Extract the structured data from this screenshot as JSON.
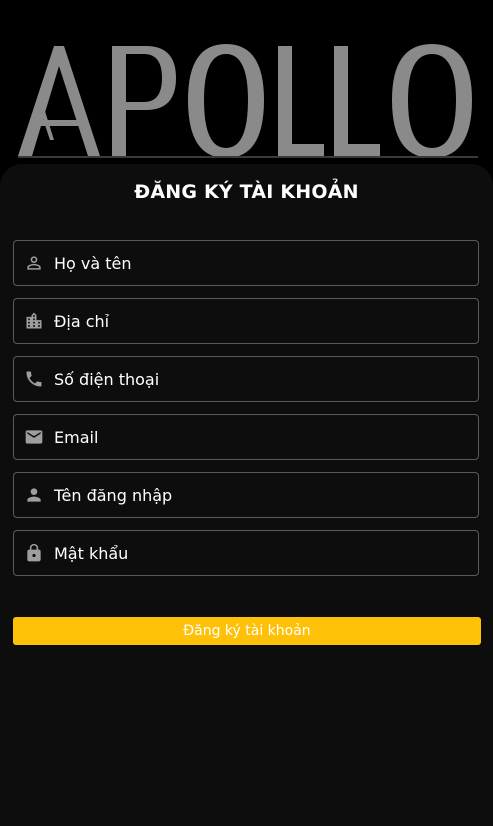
{
  "brand": {
    "logo_text": "APOLLO"
  },
  "form": {
    "title": "ĐĂNG KÝ TÀI KHOẢN",
    "fields": [
      {
        "label": "Họ và tên",
        "icon": "person-outline-icon"
      },
      {
        "label": "Địa chỉ",
        "icon": "city-icon"
      },
      {
        "label": "Số điện thoại",
        "icon": "phone-icon"
      },
      {
        "label": "Email",
        "icon": "mail-icon"
      },
      {
        "label": "Tên đăng nhập",
        "icon": "person-icon"
      },
      {
        "label": "Mật khẩu",
        "icon": "lock-icon"
      }
    ],
    "submit_label": "Đăng ký tài khoản"
  },
  "colors": {
    "background": "#000000",
    "card": "#0d0d0d",
    "field_border": "#5a5a5a",
    "icon": "#9e9e9e",
    "accent": "#ffc107",
    "text": "#ffffff"
  }
}
